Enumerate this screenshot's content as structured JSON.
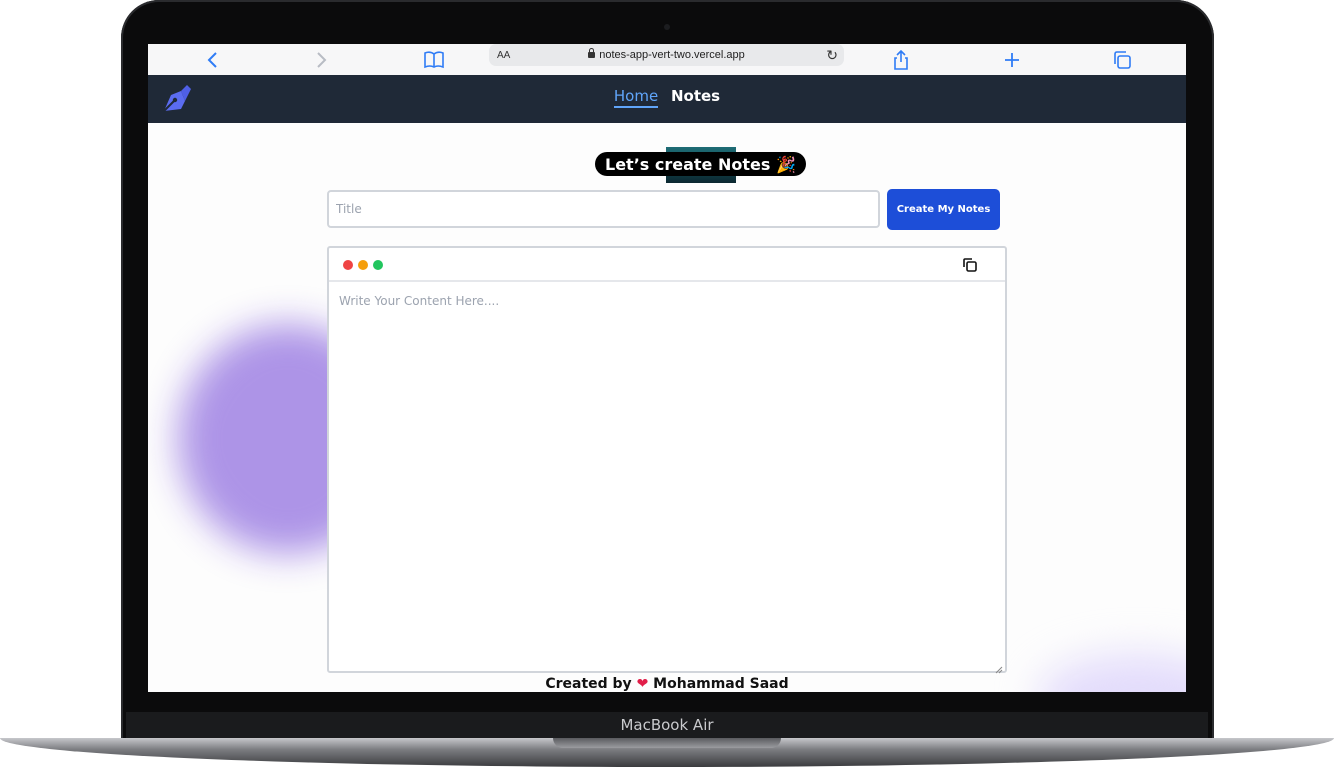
{
  "device": {
    "label": "MacBook Air"
  },
  "browser": {
    "url_text_size": "AA",
    "url": "notes-app-vert-two.vercel.app",
    "icons": [
      "back-icon",
      "forward-icon",
      "bookmarks-icon",
      "reload-icon",
      "share-icon",
      "new-tab-icon",
      "tabs-icon"
    ]
  },
  "nav": {
    "links": [
      {
        "label": "Home",
        "active": true
      },
      {
        "label": "Notes",
        "active": false
      }
    ]
  },
  "main": {
    "heading": "Let’s create Notes 🎉",
    "title_placeholder": "Title",
    "create_button": "Create My Notes",
    "content_placeholder": "Write Your Content Here...."
  },
  "footer": {
    "prefix": "Created by",
    "heart": "❤",
    "author": "Mohammad Saad"
  },
  "colors": {
    "nav_bg": "#1f2937",
    "accent": "#1d4ed8",
    "active_link": "#60a5fa",
    "dot_red": "#ef4444",
    "dot_yellow": "#f59e0b",
    "dot_green": "#22c55e"
  }
}
